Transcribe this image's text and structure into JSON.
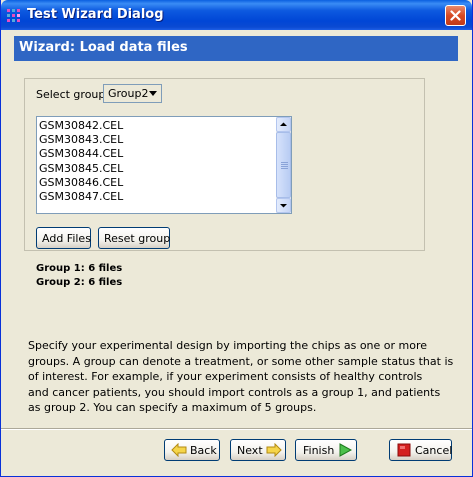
{
  "window": {
    "title": "Test Wizard Dialog"
  },
  "header": {
    "title": "Wizard: Load data files"
  },
  "group_select": {
    "label": "Select group:",
    "value": "Group2"
  },
  "file_list": {
    "items": [
      "GSM30842.CEL",
      "GSM30843.CEL",
      "GSM30844.CEL",
      "GSM30845.CEL",
      "GSM30846.CEL",
      "GSM30847.CEL"
    ]
  },
  "actions": {
    "add_files": "Add Files",
    "reset_group": "Reset group"
  },
  "summary": [
    "Group 1: 6 files",
    "Group 2: 6 files"
  ],
  "description": [
    "Specify your experimental design by importing the chips as one or more",
    "groups. A group can denote a treatment, or some other sample status that is",
    "of interest. For example, if your experiment consists of healthy controls",
    "and cancer patients, you should import controls as a group 1, and patients",
    "as group 2. You can specify a maximum of 5 groups."
  ],
  "footer": {
    "back": "Back",
    "next": "Next",
    "finish": "Finish",
    "cancel": "Cancel"
  },
  "colors": {
    "titlebar": "#0b4ad2",
    "header_bar": "#2f66c4",
    "window_bg": "#ece9d8",
    "arrow_yellow": "#f5d54a",
    "finish_green": "#2e9e2e",
    "cancel_red": "#d42020"
  },
  "icons": {
    "app": "app-grid-icon",
    "close": "close-icon",
    "back": "arrow-left-icon",
    "next": "arrow-right-icon",
    "finish": "play-icon",
    "cancel": "stop-icon"
  }
}
